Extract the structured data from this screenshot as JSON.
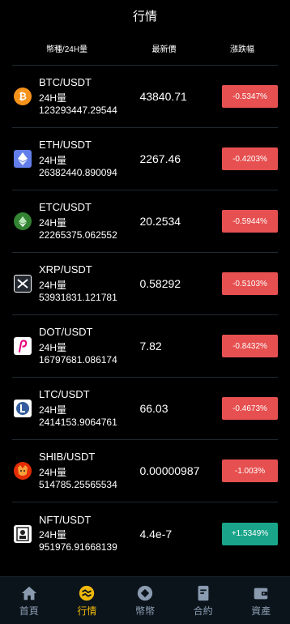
{
  "header": {
    "title": "行情"
  },
  "columns": {
    "pair": "幣種/24H量",
    "price": "最新價",
    "change": "漲跌幅"
  },
  "vol_label": "24H量",
  "rows": [
    {
      "pair": "BTC/USDT",
      "volume": "123293447.29544",
      "price": "43840.71",
      "change": "-0.5347%",
      "trend": "down",
      "icon": "bitcoin-icon",
      "color": "#f7931a"
    },
    {
      "pair": "ETH/USDT",
      "volume": "26382440.890094",
      "price": "2267.46",
      "change": "-0.4203%",
      "trend": "down",
      "icon": "ethereum-icon",
      "color": "#627eea"
    },
    {
      "pair": "ETC/USDT",
      "volume": "22265375.062552",
      "price": "20.2534",
      "change": "-0.5944%",
      "trend": "down",
      "icon": "ethereum-classic-icon",
      "color": "#328332"
    },
    {
      "pair": "XRP/USDT",
      "volume": "53931831.121781",
      "price": "0.58292",
      "change": "-0.5103%",
      "trend": "down",
      "icon": "xrp-icon",
      "color": "#23292f"
    },
    {
      "pair": "DOT/USDT",
      "volume": "16797681.086174",
      "price": "7.82",
      "change": "-0.8432%",
      "trend": "down",
      "icon": "polkadot-icon",
      "color": "#ffffff"
    },
    {
      "pair": "LTC/USDT",
      "volume": "2414153.9064761",
      "price": "66.03",
      "change": "-0.4673%",
      "trend": "down",
      "icon": "litecoin-icon",
      "color": "#ffffff"
    },
    {
      "pair": "SHIB/USDT",
      "volume": "514785.25565534",
      "price": "0.00000987",
      "change": "-1.003%",
      "trend": "down",
      "icon": "shiba-icon",
      "color": "#e42d04"
    },
    {
      "pair": "NFT/USDT",
      "volume": "951976.91668139",
      "price": "4.4e-7",
      "change": "+1.5349%",
      "trend": "up",
      "icon": "nft-icon",
      "color": "#ffffff"
    }
  ],
  "tabs": [
    {
      "label": "首頁",
      "icon": "home-icon",
      "active": false
    },
    {
      "label": "行情",
      "icon": "market-icon",
      "active": true
    },
    {
      "label": "幣幣",
      "icon": "coin-icon",
      "active": false
    },
    {
      "label": "合約",
      "icon": "contract-icon",
      "active": false
    },
    {
      "label": "資產",
      "icon": "wallet-icon",
      "active": false
    }
  ]
}
